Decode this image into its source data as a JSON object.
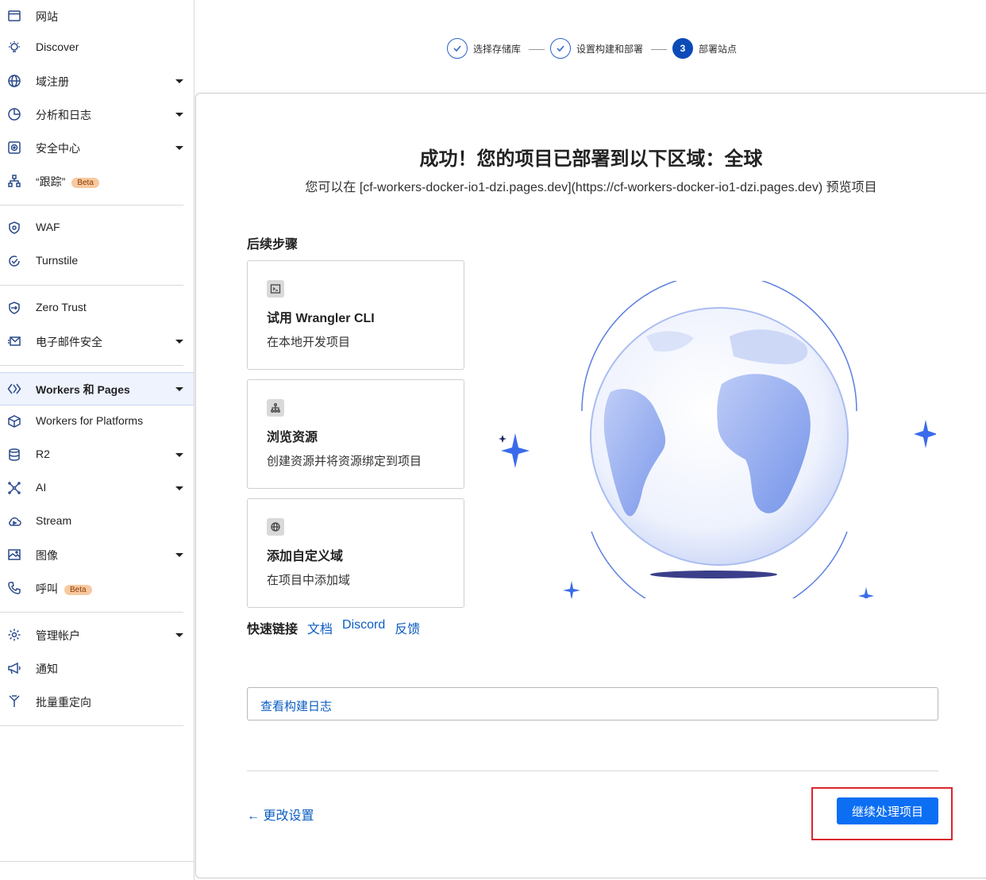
{
  "sidebar": {
    "items": [
      {
        "label": "网站",
        "icon": "browser-window-icon",
        "caret": false
      },
      {
        "label": "Discover",
        "icon": "lightbulb-icon",
        "caret": false
      },
      {
        "label": "域注册",
        "icon": "globe-icon",
        "caret": true
      },
      {
        "label": "分析和日志",
        "icon": "pie-chart-icon",
        "caret": true
      },
      {
        "label": "安全中心",
        "icon": "security-center-icon",
        "caret": true
      },
      {
        "label": "“跟踪”",
        "icon": "trace-icon",
        "caret": false,
        "badge": "Beta"
      },
      {
        "label": "WAF",
        "icon": "waf-shield-icon",
        "caret": false
      },
      {
        "label": "Turnstile",
        "icon": "turnstile-icon",
        "caret": false
      },
      {
        "label": "Zero Trust",
        "icon": "zero-trust-icon",
        "caret": false
      },
      {
        "label": "电子邮件安全",
        "icon": "email-icon",
        "caret": true
      },
      {
        "label": "Workers 和 Pages",
        "icon": "workers-icon",
        "caret": true,
        "active": true
      },
      {
        "label": "Workers for Platforms",
        "icon": "cube-icon",
        "caret": false
      },
      {
        "label": "R2",
        "icon": "database-icon",
        "caret": true
      },
      {
        "label": "AI",
        "icon": "ai-sparkle-icon",
        "caret": true
      },
      {
        "label": "Stream",
        "icon": "stream-cloud-icon",
        "caret": false
      },
      {
        "label": "图像",
        "icon": "image-icon",
        "caret": true
      },
      {
        "label": "呼叫",
        "icon": "phone-icon",
        "caret": false,
        "badge": "Beta"
      },
      {
        "label": "管理帐户",
        "icon": "gear-icon",
        "caret": true
      },
      {
        "label": "通知",
        "icon": "megaphone-icon",
        "caret": false
      },
      {
        "label": "批量重定向",
        "icon": "redirect-icon",
        "caret": false
      }
    ]
  },
  "stepper": {
    "steps": [
      {
        "label": "选择存储库",
        "state": "done"
      },
      {
        "label": "设置构建和部署",
        "state": "done"
      },
      {
        "label": "部署站点",
        "state": "current",
        "number": "3"
      }
    ]
  },
  "main": {
    "title": "成功！您的项目已部署到以下区域：全球",
    "subtitle": "您可以在 [cf-workers-docker-io1-dzi.pages.dev](https://cf-workers-docker-io1-dzi.pages.dev) 预览项目",
    "next_steps_heading": "后续步骤",
    "tiles": [
      {
        "title": "试用 Wrangler CLI",
        "desc": "在本地开发项目",
        "icon": "terminal-icon"
      },
      {
        "title": "浏览资源",
        "desc": "创建资源并将资源绑定到项目",
        "icon": "hierarchy-icon"
      },
      {
        "title": "添加自定义域",
        "desc": "在项目中添加域",
        "icon": "globe-icon"
      }
    ],
    "quick_links": {
      "label": "快速链接",
      "links": [
        "文档",
        "Discord",
        "反馈"
      ]
    },
    "view_logs": "查看构建日志",
    "back": "← 更改设置",
    "continue": "继续处理项目"
  },
  "colors": {
    "accent": "#0b6ef3",
    "link": "#0b5dc1",
    "step_done": "#2c62c8",
    "highlight": "#d9262e"
  }
}
